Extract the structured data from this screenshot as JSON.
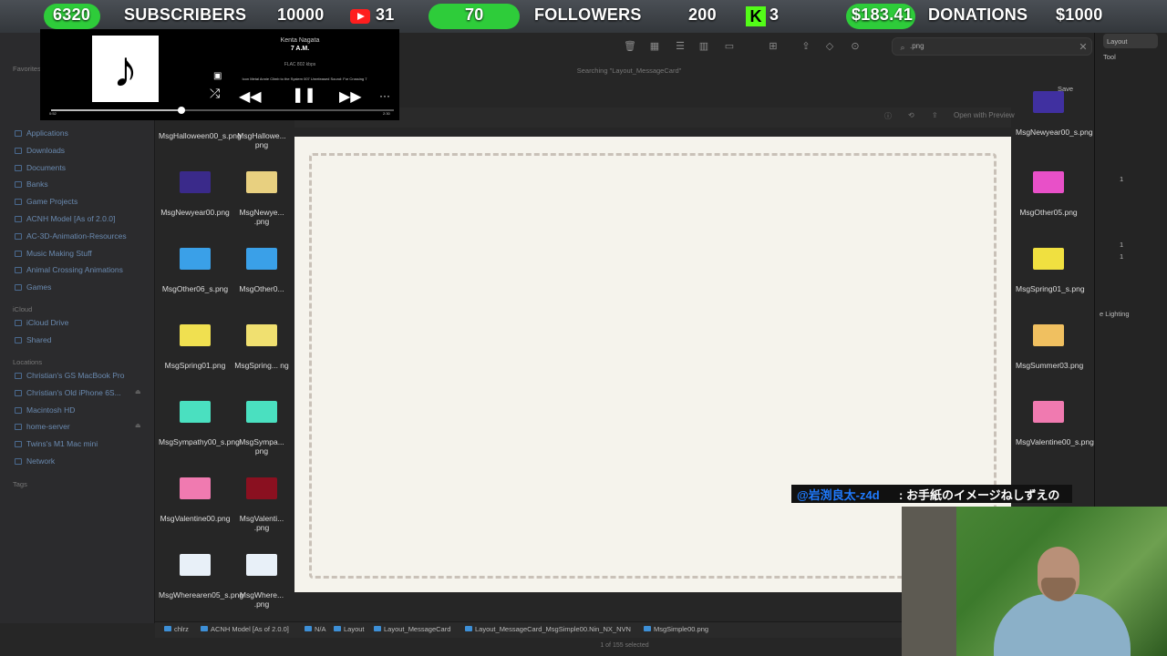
{
  "stats": {
    "subs_count": "6320",
    "subs_label": "SUBSCRIBERS",
    "subs_goal": "10000",
    "yt_count": "31",
    "followers_count": "70",
    "followers_label": "FOLLOWERS",
    "followers_goal": "200",
    "kick_count": "3",
    "donation_amount": "$183.41",
    "donations_label": "DONATIONS",
    "donation_goal": "$1000",
    "kick_letter": "K",
    "colors": {
      "pill": "#2ecc3a",
      "youtube": "#ff1e1e",
      "kick": "#53fc18"
    }
  },
  "player": {
    "artist": "Kenta Nagata",
    "title": "7 A.M.",
    "format": "FLAC 802 kbps",
    "path": "Icon Metal Annie Climb to the System 007 Unreleased Sound: For Crossing 7",
    "time_elapsed": "0:52",
    "time_total": "2:30",
    "progress_fraction": 0.38,
    "album_icon": "music-note-icon",
    "prev_icon": "rewind-icon",
    "play_icon": "pause-icon",
    "next_icon": "fast-forward-icon",
    "shuffle_icon": "shuffle-icon",
    "more_icon": "more-icon"
  },
  "sidebar": {
    "favorites_label": "Favorites",
    "items": [
      {
        "label": "Applications"
      },
      {
        "label": "Downloads"
      },
      {
        "label": "Documents"
      },
      {
        "label": "Banks"
      },
      {
        "label": "Game Projects"
      },
      {
        "label": "ACNH Model [As of 2.0.0]"
      },
      {
        "label": "AC-3D-Animation-Resources"
      },
      {
        "label": "Music Making Stuff"
      },
      {
        "label": "Animal Crossing Animations"
      },
      {
        "label": "Games"
      }
    ],
    "icloud_label": "iCloud",
    "icloud_items": [
      {
        "label": "iCloud Drive"
      },
      {
        "label": "Shared"
      }
    ],
    "locations_label": "Locations",
    "locations": [
      {
        "label": "Christian's GS MacBook Pro"
      },
      {
        "label": "Christian's Old iPhone 6S..."
      },
      {
        "label": "Macintosh HD"
      },
      {
        "label": "home-server"
      },
      {
        "label": "Twins's M1 Mac mini"
      },
      {
        "label": "Network"
      }
    ],
    "tags_label": "Tags"
  },
  "search": {
    "value": ".png",
    "searching_text": "Searching \"Layout_MessageCard\""
  },
  "files_col1": [
    {
      "name": "MsgHalloween00_s.png",
      "color": "#5a1a7a"
    },
    {
      "name": "MsgNewyear00.png",
      "color": "#3a2a8a"
    },
    {
      "name": "MsgOther06_s.png",
      "color": "#3aa0e8"
    },
    {
      "name": "MsgSpring01.png",
      "color": "#f0e050"
    },
    {
      "name": "MsgSympathy00_s.png",
      "color": "#4ae0c0"
    },
    {
      "name": "MsgValentine00.png",
      "color": "#f07ab0"
    },
    {
      "name": "MsgWherearen05_s.png",
      "color": "#e8f0f8"
    }
  ],
  "files_col2": [
    {
      "name": "MsgHallowe... png",
      "color": "#5a1a7a"
    },
    {
      "name": "MsgNewye... .png",
      "color": "#e8d080"
    },
    {
      "name": "MsgOther0...",
      "color": "#3aa0e8"
    },
    {
      "name": "MsgSpring... ng",
      "color": "#f0e070"
    },
    {
      "name": "MsgSympa... png",
      "color": "#4ae0c0"
    },
    {
      "name": "MsgValenti... .png",
      "color": "#8a1020"
    },
    {
      "name": "MsgWhere... .png",
      "color": "#e8f0f8"
    }
  ],
  "files_col3": [
    {
      "name": "MsgNewyear00_s.png",
      "color": "#4030a0"
    },
    {
      "name": "MsgOther05.png",
      "color": "#e850c8"
    },
    {
      "name": "MsgSpring01_s.png",
      "color": "#f0e040"
    },
    {
      "name": "MsgSummer03.png",
      "color": "#f0c060"
    },
    {
      "name": "MsgValentine00_s.png",
      "color": "#f07ab0"
    }
  ],
  "preview": {
    "open_with": "Open with Preview"
  },
  "right_panel": {
    "layout_label": "Layout",
    "tool_label": "Tool",
    "save_label": "Save",
    "lighting_label": "e Lighting",
    "num1": "1",
    "num2": "1",
    "num3": "1"
  },
  "pathbar": [
    {
      "label": "chlrz"
    },
    {
      "label": "ACNH Model [As of 2.0.0]"
    },
    {
      "label": "N/A"
    },
    {
      "label": "Layout"
    },
    {
      "label": "Layout_MessageCard"
    },
    {
      "label": "Layout_MessageCard_MsgSimple00.Nin_NX_NVN"
    },
    {
      "label": "MsgSimple00.png"
    }
  ],
  "status": "1 of 155 selected",
  "chat": {
    "user": "@岩渕良太-z4d",
    "message": ": お手紙のイメージねしずえの"
  }
}
